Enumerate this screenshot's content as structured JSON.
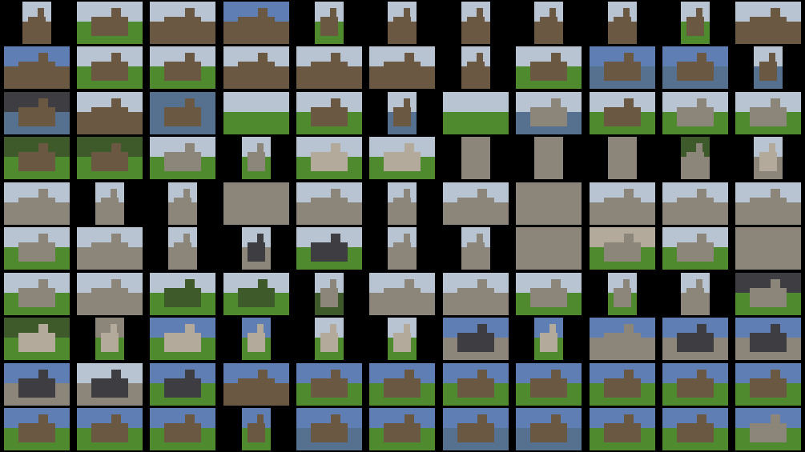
{
  "sheet": {
    "columns": 11,
    "rows": 10,
    "background": "#000000",
    "scene_colors": {
      "sky": "#b9c4d3",
      "sky_blue": "#5f7fb4",
      "sea": "#55718f",
      "grass": "#4f8a2f",
      "rock": "#6b5843",
      "stone": "#8c8579",
      "stone_light": "#b3aa9b",
      "slate": "#3d3d42",
      "trees": "#3f5a2a"
    }
  },
  "thumbnails": [
    {
      "o": "p",
      "sky": "sky",
      "ground": "rock",
      "subject": "rock"
    },
    {
      "o": "l",
      "sky": "sky",
      "ground": "grass",
      "subject": "rock"
    },
    {
      "o": "l",
      "sky": "sky",
      "ground": "rock",
      "subject": "rock"
    },
    {
      "o": "l",
      "sky": "sky_blue",
      "ground": "rock",
      "subject": "rock"
    },
    {
      "o": "p",
      "sky": "sky",
      "ground": "grass",
      "subject": "rock"
    },
    {
      "o": "p",
      "sky": "sky",
      "ground": "rock",
      "subject": "rock"
    },
    {
      "o": "p",
      "sky": "sky",
      "ground": "rock",
      "subject": "rock"
    },
    {
      "o": "p",
      "sky": "sky",
      "ground": "rock",
      "subject": "rock"
    },
    {
      "o": "p",
      "sky": "sky",
      "ground": "rock",
      "subject": "rock"
    },
    {
      "o": "p",
      "sky": "sky",
      "ground": "grass",
      "subject": "rock"
    },
    {
      "o": "l",
      "sky": "sky",
      "ground": "rock",
      "subject": "rock"
    },
    {
      "o": "l",
      "sky": "sky_blue",
      "ground": "rock",
      "subject": "rock"
    },
    {
      "o": "l",
      "sky": "sky",
      "ground": "grass",
      "subject": "rock"
    },
    {
      "o": "l",
      "sky": "sky",
      "ground": "grass",
      "subject": "rock"
    },
    {
      "o": "l",
      "sky": "sky",
      "ground": "rock",
      "subject": "rock"
    },
    {
      "o": "l",
      "sky": "sky",
      "ground": "rock",
      "subject": "rock"
    },
    {
      "o": "l",
      "sky": "sky",
      "ground": "rock",
      "subject": "rock"
    },
    {
      "o": "p",
      "sky": "sky",
      "ground": "rock",
      "subject": "rock"
    },
    {
      "o": "l",
      "sky": "sky",
      "ground": "grass",
      "subject": "rock"
    },
    {
      "o": "l",
      "sky": "sky_blue",
      "ground": "sea",
      "subject": "rock"
    },
    {
      "o": "l",
      "sky": "sky_blue",
      "ground": "sea",
      "subject": "rock"
    },
    {
      "o": "p",
      "sky": "sky",
      "ground": "sea",
      "subject": "rock"
    },
    {
      "o": "l",
      "sky": "slate",
      "ground": "sea",
      "subject": "rock"
    },
    {
      "o": "l",
      "sky": "sky",
      "ground": "rock",
      "subject": "rock"
    },
    {
      "o": "l",
      "sky": "sea",
      "ground": "sea",
      "subject": "rock"
    },
    {
      "o": "l",
      "sky": "sky",
      "ground": "grass",
      "subject": "none"
    },
    {
      "o": "l",
      "sky": "sky",
      "ground": "grass",
      "subject": "rock"
    },
    {
      "o": "p",
      "sky": "sky",
      "ground": "sea",
      "subject": "rock"
    },
    {
      "o": "l",
      "sky": "sky",
      "ground": "grass",
      "subject": "none"
    },
    {
      "o": "l",
      "sky": "sky",
      "ground": "sea",
      "subject": "stone"
    },
    {
      "o": "l",
      "sky": "sky",
      "ground": "grass",
      "subject": "rock"
    },
    {
      "o": "l",
      "sky": "sky",
      "ground": "grass",
      "subject": "stone"
    },
    {
      "o": "l",
      "sky": "sky",
      "ground": "grass",
      "subject": "stone"
    },
    {
      "o": "l",
      "sky": "trees",
      "ground": "grass",
      "subject": "rock"
    },
    {
      "o": "l",
      "sky": "trees",
      "ground": "grass",
      "subject": "rock"
    },
    {
      "o": "l",
      "sky": "sky",
      "ground": "grass",
      "subject": "stone"
    },
    {
      "o": "p",
      "sky": "sky",
      "ground": "grass",
      "subject": "stone"
    },
    {
      "o": "l",
      "sky": "sky",
      "ground": "grass",
      "subject": "stone_light"
    },
    {
      "o": "l",
      "sky": "sky",
      "ground": "grass",
      "subject": "stone_light"
    },
    {
      "o": "p",
      "sky": "stone",
      "ground": "stone",
      "subject": "stone"
    },
    {
      "o": "p",
      "sky": "stone",
      "ground": "stone",
      "subject": "stone"
    },
    {
      "o": "p",
      "sky": "stone",
      "ground": "stone",
      "subject": "stone"
    },
    {
      "o": "p",
      "sky": "trees",
      "ground": "stone",
      "subject": "stone"
    },
    {
      "o": "p",
      "sky": "sky",
      "ground": "stone",
      "subject": "stone_light"
    },
    {
      "o": "l",
      "sky": "sky",
      "ground": "stone",
      "subject": "stone"
    },
    {
      "o": "p",
      "sky": "sky",
      "ground": "stone",
      "subject": "stone"
    },
    {
      "o": "p",
      "sky": "sky",
      "ground": "stone",
      "subject": "stone"
    },
    {
      "o": "l",
      "sky": "stone",
      "ground": "stone",
      "subject": "stone"
    },
    {
      "o": "l",
      "sky": "sky",
      "ground": "stone",
      "subject": "stone"
    },
    {
      "o": "p",
      "sky": "sky",
      "ground": "stone",
      "subject": "stone"
    },
    {
      "o": "l",
      "sky": "sky",
      "ground": "stone",
      "subject": "stone"
    },
    {
      "o": "l",
      "sky": "stone",
      "ground": "stone",
      "subject": "stone"
    },
    {
      "o": "l",
      "sky": "sky",
      "ground": "stone",
      "subject": "stone"
    },
    {
      "o": "l",
      "sky": "sky",
      "ground": "stone",
      "subject": "stone"
    },
    {
      "o": "l",
      "sky": "sky",
      "ground": "stone",
      "subject": "stone"
    },
    {
      "o": "l",
      "sky": "sky",
      "ground": "grass",
      "subject": "stone"
    },
    {
      "o": "l",
      "sky": "sky",
      "ground": "stone",
      "subject": "stone"
    },
    {
      "o": "p",
      "sky": "sky",
      "ground": "stone",
      "subject": "stone"
    },
    {
      "o": "p",
      "sky": "sky",
      "ground": "stone",
      "subject": "slate"
    },
    {
      "o": "l",
      "sky": "sky",
      "ground": "grass",
      "subject": "slate"
    },
    {
      "o": "p",
      "sky": "sky",
      "ground": "stone",
      "subject": "stone"
    },
    {
      "o": "p",
      "sky": "sky",
      "ground": "stone",
      "subject": "stone"
    },
    {
      "o": "l",
      "sky": "stone",
      "ground": "stone",
      "subject": "stone"
    },
    {
      "o": "l",
      "sky": "stone_light",
      "ground": "grass",
      "subject": "stone"
    },
    {
      "o": "l",
      "sky": "sky",
      "ground": "grass",
      "subject": "stone"
    },
    {
      "o": "l",
      "sky": "stone",
      "ground": "stone",
      "subject": "stone"
    },
    {
      "o": "l",
      "sky": "sky",
      "ground": "grass",
      "subject": "stone"
    },
    {
      "o": "l",
      "sky": "sky",
      "ground": "stone",
      "subject": "stone"
    },
    {
      "o": "l",
      "sky": "sky",
      "ground": "grass",
      "subject": "trees"
    },
    {
      "o": "l",
      "sky": "sky",
      "ground": "grass",
      "subject": "trees"
    },
    {
      "o": "p",
      "sky": "sky",
      "ground": "trees",
      "subject": "stone"
    },
    {
      "o": "l",
      "sky": "sky",
      "ground": "stone",
      "subject": "stone"
    },
    {
      "o": "l",
      "sky": "sky",
      "ground": "stone",
      "subject": "stone"
    },
    {
      "o": "l",
      "sky": "sky",
      "ground": "grass",
      "subject": "stone"
    },
    {
      "o": "p",
      "sky": "sky",
      "ground": "grass",
      "subject": "stone"
    },
    {
      "o": "p",
      "sky": "sky",
      "ground": "stone",
      "subject": "stone"
    },
    {
      "o": "l",
      "sky": "slate",
      "ground": "grass",
      "subject": "stone"
    },
    {
      "o": "l",
      "sky": "trees",
      "ground": "grass",
      "subject": "stone_light"
    },
    {
      "o": "p",
      "sky": "stone",
      "ground": "grass",
      "subject": "stone_light"
    },
    {
      "o": "l",
      "sky": "sky_blue",
      "ground": "grass",
      "subject": "stone_light"
    },
    {
      "o": "p",
      "sky": "sky_blue",
      "ground": "grass",
      "subject": "stone_light"
    },
    {
      "o": "p",
      "sky": "sky",
      "ground": "grass",
      "subject": "stone_light"
    },
    {
      "o": "p",
      "sky": "sky",
      "ground": "grass",
      "subject": "stone_light"
    },
    {
      "o": "l",
      "sky": "sky_blue",
      "ground": "stone",
      "subject": "slate"
    },
    {
      "o": "p",
      "sky": "sky_blue",
      "ground": "grass",
      "subject": "stone_light"
    },
    {
      "o": "l",
      "sky": "sky_blue",
      "ground": "stone",
      "subject": "stone"
    },
    {
      "o": "l",
      "sky": "sky_blue",
      "ground": "stone",
      "subject": "slate"
    },
    {
      "o": "l",
      "sky": "sky_blue",
      "ground": "stone",
      "subject": "slate"
    },
    {
      "o": "l",
      "sky": "sky_blue",
      "ground": "stone",
      "subject": "slate"
    },
    {
      "o": "l",
      "sky": "sky",
      "ground": "stone",
      "subject": "slate"
    },
    {
      "o": "l",
      "sky": "sky_blue",
      "ground": "grass",
      "subject": "slate"
    },
    {
      "o": "l",
      "sky": "sky_blue",
      "ground": "rock",
      "subject": "rock"
    },
    {
      "o": "l",
      "sky": "sky_blue",
      "ground": "grass",
      "subject": "rock"
    },
    {
      "o": "l",
      "sky": "sky_blue",
      "ground": "grass",
      "subject": "rock"
    },
    {
      "o": "l",
      "sky": "sky_blue",
      "ground": "grass",
      "subject": "rock"
    },
    {
      "o": "l",
      "sky": "sky_blue",
      "ground": "grass",
      "subject": "rock"
    },
    {
      "o": "l",
      "sky": "sky_blue",
      "ground": "grass",
      "subject": "rock"
    },
    {
      "o": "l",
      "sky": "sky_blue",
      "ground": "grass",
      "subject": "rock"
    },
    {
      "o": "l",
      "sky": "sky_blue",
      "ground": "grass",
      "subject": "rock"
    },
    {
      "o": "l",
      "sky": "sky_blue",
      "ground": "grass",
      "subject": "rock"
    },
    {
      "o": "l",
      "sky": "sky_blue",
      "ground": "grass",
      "subject": "rock"
    },
    {
      "o": "l",
      "sky": "sky_blue",
      "ground": "grass",
      "subject": "rock"
    },
    {
      "o": "p",
      "sky": "sky_blue",
      "ground": "grass",
      "subject": "rock"
    },
    {
      "o": "l",
      "sky": "sky_blue",
      "ground": "sea",
      "subject": "rock"
    },
    {
      "o": "l",
      "sky": "sky_blue",
      "ground": "grass",
      "subject": "rock"
    },
    {
      "o": "l",
      "sky": "sky_blue",
      "ground": "sea",
      "subject": "rock"
    },
    {
      "o": "l",
      "sky": "sky_blue",
      "ground": "sea",
      "subject": "rock"
    },
    {
      "o": "l",
      "sky": "sky_blue",
      "ground": "grass",
      "subject": "rock"
    },
    {
      "o": "l",
      "sky": "sky_blue",
      "ground": "grass",
      "subject": "rock"
    },
    {
      "o": "l",
      "sky": "sky_blue",
      "ground": "grass",
      "subject": "stone"
    }
  ]
}
